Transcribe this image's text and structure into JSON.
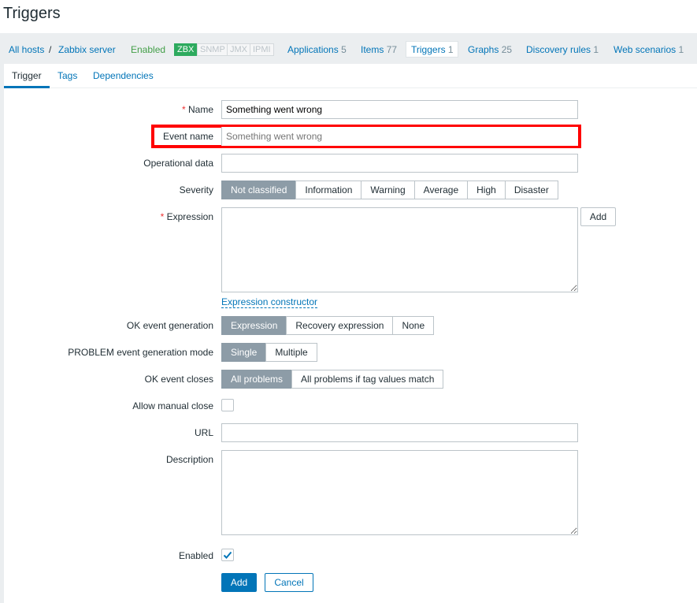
{
  "title": "Triggers",
  "breadcrumb": {
    "all_hosts": "All hosts",
    "sep": "/",
    "host": "Zabbix server",
    "status": "Enabled"
  },
  "badges": [
    "ZBX",
    "SNMP",
    "JMX",
    "IPMI"
  ],
  "host_tabs": [
    {
      "label": "Applications",
      "count": "5"
    },
    {
      "label": "Items",
      "count": "77"
    },
    {
      "label": "Triggers",
      "count": "1"
    },
    {
      "label": "Graphs",
      "count": "25"
    },
    {
      "label": "Discovery rules",
      "count": "1"
    },
    {
      "label": "Web scenarios",
      "count": "1"
    }
  ],
  "form_tabs": [
    "Trigger",
    "Tags",
    "Dependencies"
  ],
  "form": {
    "name_label": "Name",
    "name_value": "Something went wrong",
    "event_name_label": "Event name",
    "event_name_placeholder": "Something went wrong",
    "opdata_label": "Operational data",
    "severity_label": "Severity",
    "severity_options": [
      "Not classified",
      "Information",
      "Warning",
      "Average",
      "High",
      "Disaster"
    ],
    "severity_selected": "Not classified",
    "expression_label": "Expression",
    "expression_add": "Add",
    "expression_constructor": "Expression constructor",
    "ok_gen_label": "OK event generation",
    "ok_gen_options": [
      "Expression",
      "Recovery expression",
      "None"
    ],
    "ok_gen_selected": "Expression",
    "problem_mode_label": "PROBLEM event generation mode",
    "problem_mode_options": [
      "Single",
      "Multiple"
    ],
    "problem_mode_selected": "Single",
    "ok_closes_label": "OK event closes",
    "ok_closes_options": [
      "All problems",
      "All problems if tag values match"
    ],
    "ok_closes_selected": "All problems",
    "manual_close_label": "Allow manual close",
    "manual_close_checked": false,
    "url_label": "URL",
    "description_label": "Description",
    "enabled_label": "Enabled",
    "enabled_checked": true,
    "add_button": "Add",
    "cancel_button": "Cancel"
  },
  "colors": {
    "accent": "#0275b8",
    "highlight": "#ff0000",
    "enabled": "#429e47",
    "zbx": "#2daa5e"
  }
}
